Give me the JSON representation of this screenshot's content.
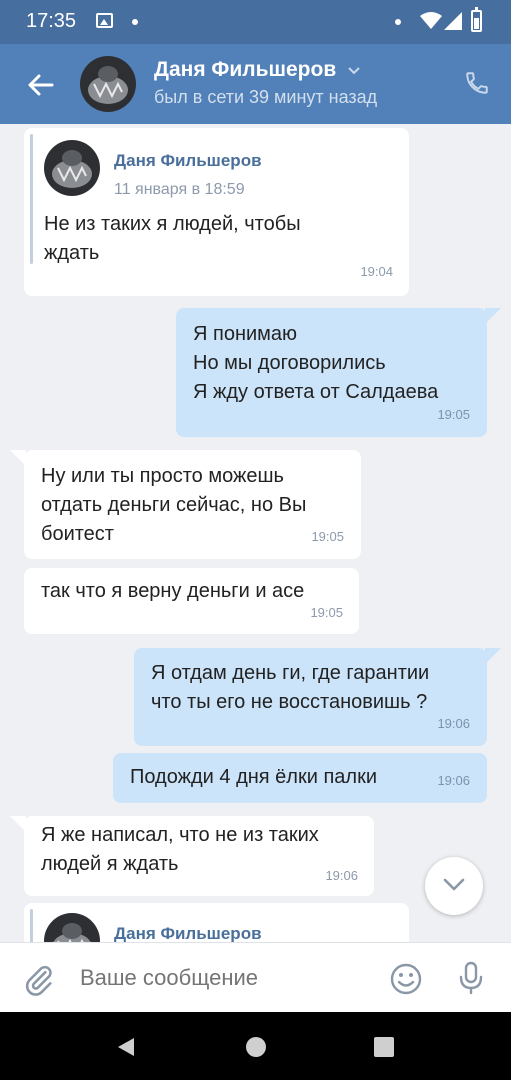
{
  "status_bar": {
    "time": "17:35"
  },
  "header": {
    "name": "Даня Фильшеров",
    "status": "был в сети 39 минут назад"
  },
  "messages": [
    {
      "direction": "in",
      "forwarded": {
        "name": "Даня Фильшеров",
        "date": "11 января в 18:59"
      },
      "lines": [
        "Не из таких я людей, чтобы",
        "ждать"
      ],
      "time": "19:04"
    },
    {
      "direction": "out",
      "lines": [
        "Я понимаю",
        "Но мы договорились",
        "Я жду ответа от Салдаева"
      ],
      "time": "19:05"
    },
    {
      "direction": "in",
      "lines": [
        "Ну или ты просто можешь",
        "отдать деньги сейчас, но Вы",
        "боитест"
      ],
      "time": "19:05"
    },
    {
      "direction": "in",
      "lines": [
        "так что я верну деньги и асе"
      ],
      "time": "19:05"
    },
    {
      "direction": "out",
      "lines": [
        "Я отдам день ги, где гарантии",
        "что ты его не восстановишь ?"
      ],
      "time": "19:06"
    },
    {
      "direction": "out",
      "lines": [
        "Подожди 4 дня ёлки палки"
      ],
      "time": "19:06"
    },
    {
      "direction": "in",
      "lines": [
        "Я же написал, что не из таких",
        "людей я ждать"
      ],
      "time": "19:06"
    },
    {
      "direction": "in",
      "forwarded": {
        "name": "Даня Фильшеров"
      }
    }
  ],
  "composer": {
    "placeholder": "Ваше сообщение"
  },
  "icons": {
    "back": "arrow-left-icon",
    "call": "phone-icon",
    "attach": "paperclip-icon",
    "emoji": "smile-icon",
    "voice": "microphone-icon",
    "scroll_down": "chevron-down-icon"
  },
  "colors": {
    "header": "#5181b8",
    "status_bar": "#466f9f",
    "outgoing_bubble": "#cce4fa",
    "incoming_bubble": "#ffffff",
    "chat_bg": "#eef0f3"
  }
}
